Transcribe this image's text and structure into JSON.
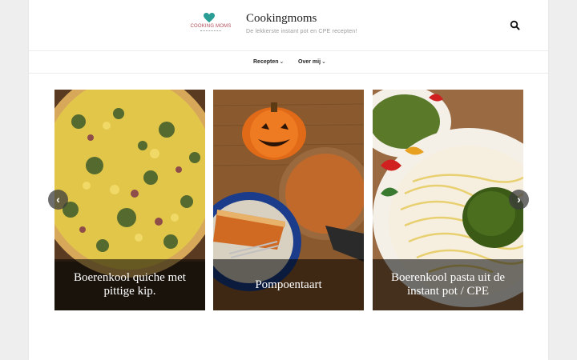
{
  "site": {
    "logo_text": "COOKING MOMS",
    "title": "Cookingmoms",
    "tagline": "De lekkerste instant pot en CPE recepten!",
    "search_icon": "search-icon"
  },
  "nav": {
    "items": [
      {
        "label": "Recepten",
        "icon": "chevron-down-icon"
      },
      {
        "label": "Over mij",
        "icon": "chevron-down-icon"
      }
    ]
  },
  "slider": {
    "prev_icon": "chevron-left-icon",
    "next_icon": "chevron-right-icon",
    "slides": [
      {
        "caption": "Boerenkool quiche met pittige kip."
      },
      {
        "caption": "Pompoentaart"
      },
      {
        "caption": "Boerenkool pasta uit de instant pot / CPE"
      }
    ]
  },
  "colors": {
    "logo_heart": "#2a9d94",
    "logo_text": "#b34a5a",
    "caption_overlay": "rgba(0,0,0,0.55)"
  }
}
